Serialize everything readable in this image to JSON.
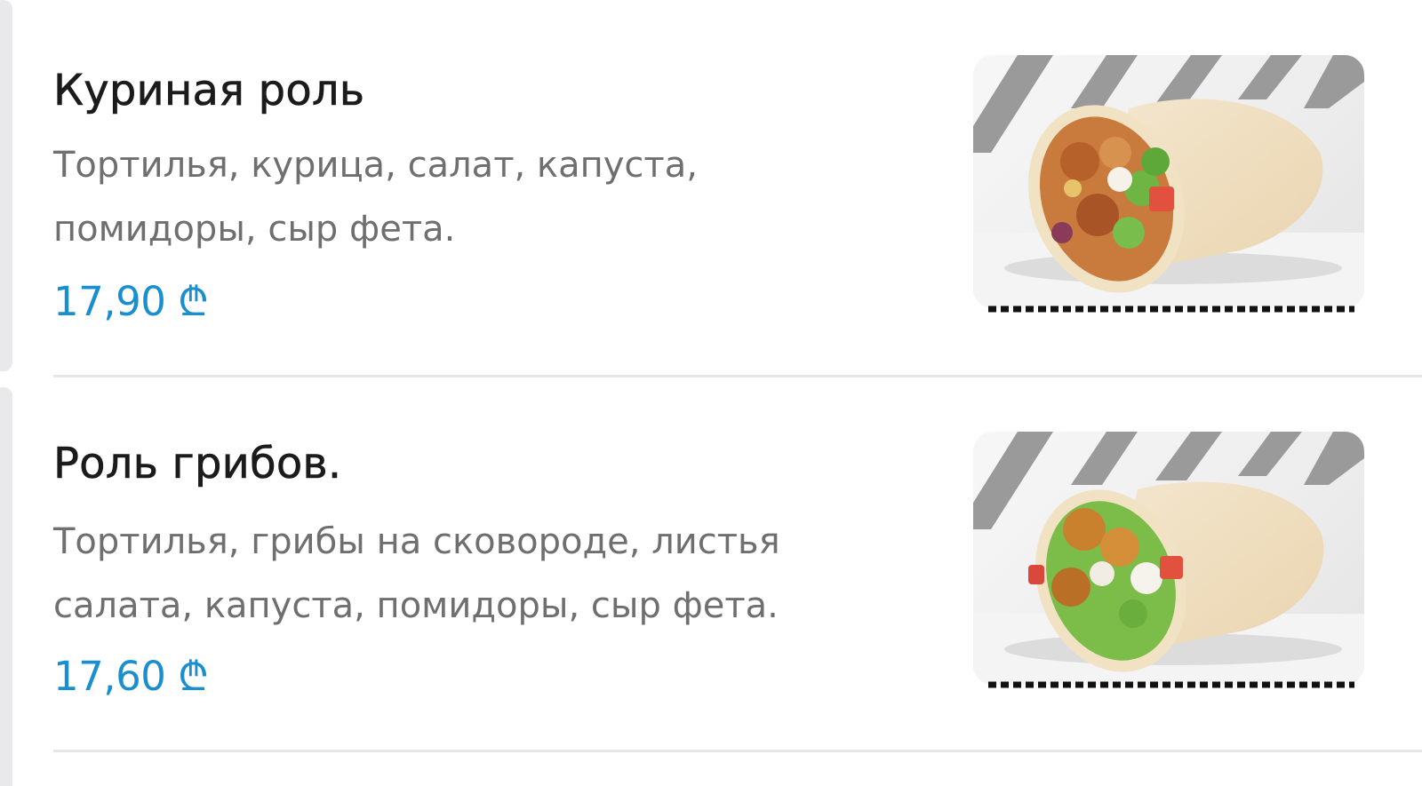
{
  "menu": {
    "items": [
      {
        "title": "Куриная роль",
        "description_line1": "Тортилья, курица, салат, капуста,",
        "description_line2": "помидоры, сыр фета.",
        "price": "17,90 ₾",
        "image": "chicken-wrap-photo"
      },
      {
        "title": "Роль грибов.",
        "description_line1": "Тортилья, грибы на сковороде, листья",
        "description_line2": "салата, капуста, помидоры, сыр фета.",
        "price": "17,60 ₾",
        "image": "mushroom-wrap-photo"
      }
    ]
  },
  "colors": {
    "title": "#1b1b1b",
    "description": "#6f6f6f",
    "price": "#1a8fcf",
    "divider": "#e6e6e8"
  }
}
